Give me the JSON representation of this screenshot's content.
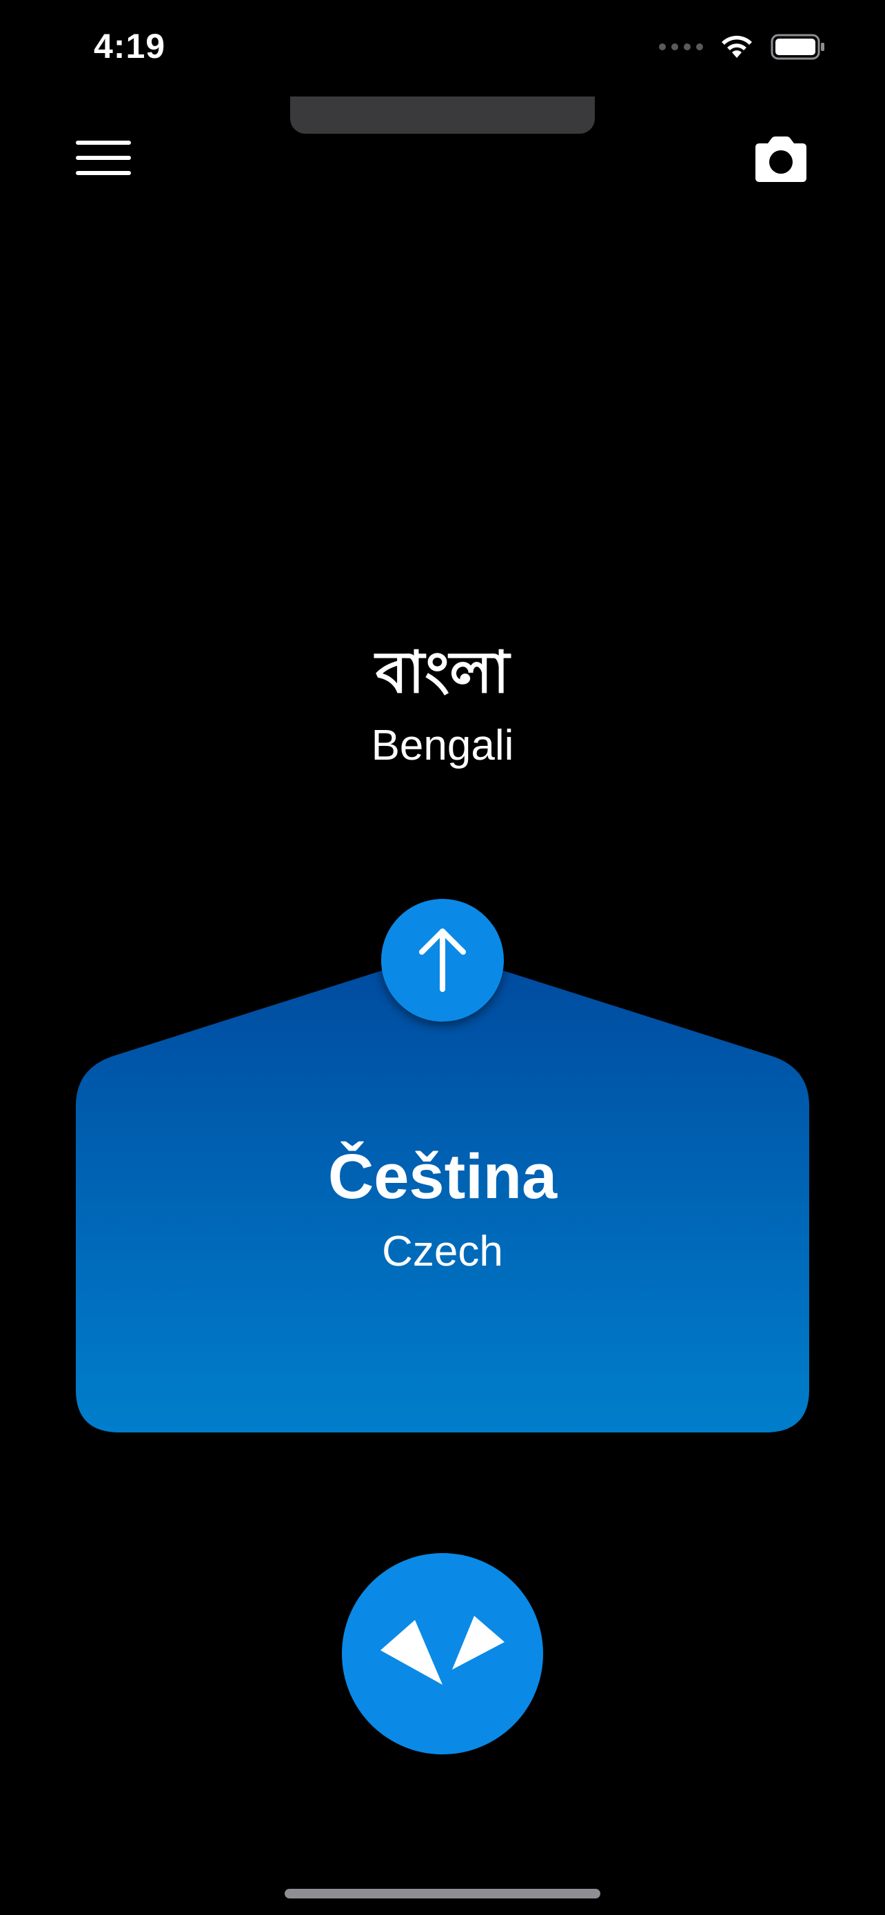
{
  "status_bar": {
    "time": "4:19"
  },
  "source_language": {
    "native_name": "বাংলা",
    "english_name": "Bengali"
  },
  "target_language": {
    "native_name": "Čeština",
    "english_name": "Czech"
  },
  "icons": {
    "menu": "hamburger-menu-icon",
    "camera": "camera-icon",
    "swap": "arrow-up-icon",
    "converse": "conversation-icon",
    "wifi": "wifi-icon",
    "battery": "battery-icon"
  },
  "colors": {
    "background": "#000000",
    "accent": "#0A8AE6",
    "card_top": "#004A9E",
    "card_bottom": "#007ECB",
    "text": "#FFFFFF"
  }
}
